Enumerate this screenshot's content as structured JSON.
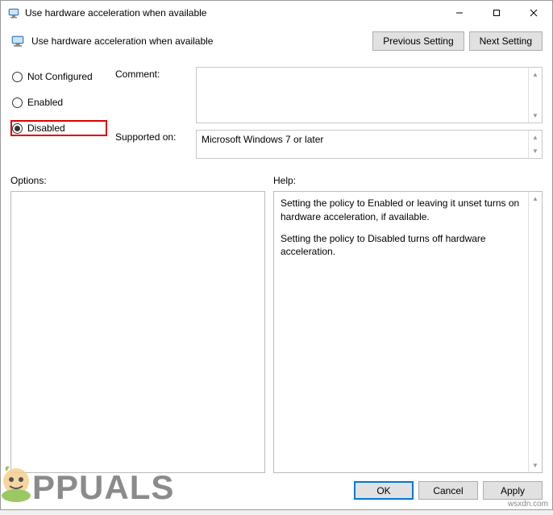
{
  "titlebar": {
    "title": "Use hardware acceleration when available"
  },
  "header": {
    "policy_title": "Use hardware acceleration when available",
    "prev_label": "Previous Setting",
    "next_label": "Next Setting"
  },
  "radios": {
    "not_configured": "Not Configured",
    "enabled": "Enabled",
    "disabled": "Disabled",
    "selected": "disabled"
  },
  "fields": {
    "comment_label": "Comment:",
    "comment_value": "",
    "supported_label": "Supported on:",
    "supported_value": "Microsoft Windows 7 or later"
  },
  "panels": {
    "options_label": "Options:",
    "help_label": "Help:",
    "help_p1": "Setting the policy to Enabled or leaving it unset turns on hardware acceleration, if available.",
    "help_p2": "Setting the policy to Disabled turns off hardware acceleration."
  },
  "footer": {
    "ok": "OK",
    "cancel": "Cancel",
    "apply": "Apply"
  },
  "watermark": {
    "brand": "PPUALS",
    "url": "wsxdn.com"
  }
}
